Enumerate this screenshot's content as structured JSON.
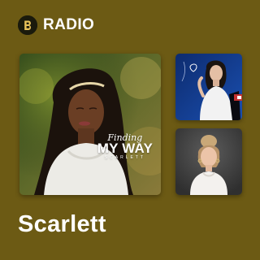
{
  "brand": {
    "label": "RADIO",
    "icon": "boomplay-logo-icon"
  },
  "covers": {
    "main": {
      "script_text": "Finding",
      "title": "MY WAY",
      "artist": "SCARLETT"
    },
    "side_top": {
      "icon": "woman-portrait-cover"
    },
    "side_bottom": {
      "icon": "woman-portrait-cover"
    }
  },
  "station": {
    "title": "Scarlett"
  },
  "colors": {
    "background": "#6c5a14",
    "text": "#ffffff"
  }
}
